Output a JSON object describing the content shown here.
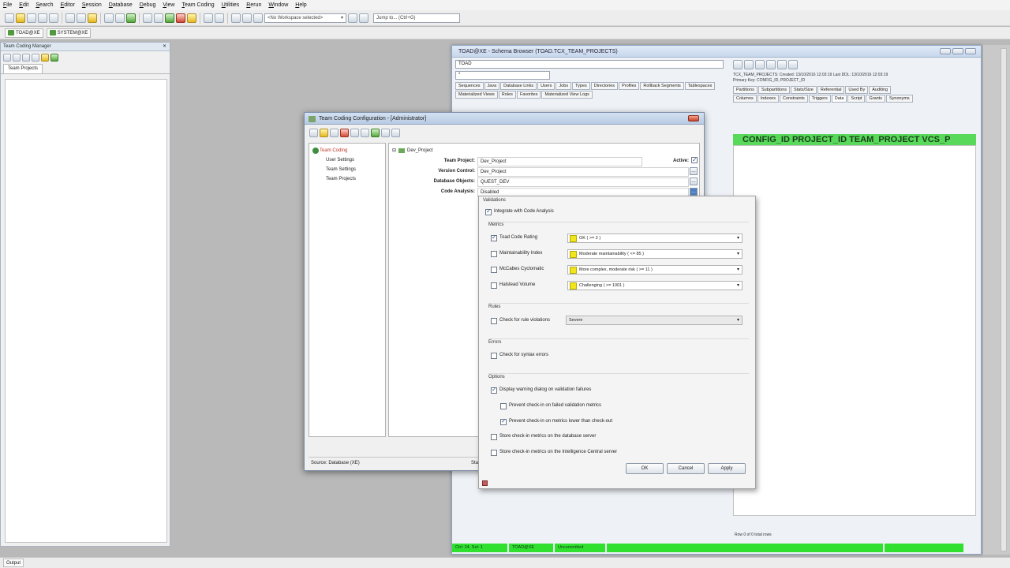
{
  "menu": [
    "File",
    "Edit",
    "Search",
    "Editor",
    "Session",
    "Database",
    "Debug",
    "View",
    "Team Coding",
    "Utilities",
    "Rerun",
    "Window",
    "Help"
  ],
  "toolbar": {
    "workspace_combo": "<No Workspace selected>",
    "jump_to": "Jump to... (Ctrl+G)"
  },
  "connections": [
    {
      "label": "TOAD@XE"
    },
    {
      "label": "SYSTEM@XE"
    }
  ],
  "left_panel": {
    "title": "Team Coding Manager",
    "tab": "Team Projects"
  },
  "bottom_bar": {
    "output_tab": "Output"
  },
  "schema_browser": {
    "title": "TOAD@XE - Schema Browser (TOAD.TCX_TEAM_PROJECTS)",
    "schema_combo": "TOAD",
    "filter_value": "*",
    "object_tabs": [
      "Sequences",
      "Java",
      "Database Links",
      "Users",
      "Jobs",
      "Types",
      "Directories",
      "Profiles",
      "Rollback Segments",
      "Tablespaces",
      "Materialized Views",
      "Roles",
      "Favorites",
      "Materialized View Logs"
    ],
    "info_line1": "TCX_TEAM_PROJECTS:  Created: 13/10/2016 12:03:19   Last DDL: 13/10/2016 12:03:19",
    "info_line2": "Primary Key: CONFIG_ID, PROJECT_ID",
    "detail_tabs_row1": [
      "Partitions",
      "Subpartitions",
      "Stats/Size",
      "Referential",
      "Used By",
      "Auditing"
    ],
    "detail_tabs_row2": [
      "Columns",
      "Indexes",
      "Constraints",
      "Triggers",
      "Data",
      "Script",
      "Grants",
      "Synonyms"
    ],
    "grid_header": "CONFIG_ID PROJECT_ID TEAM_PROJECT VCS_P",
    "row_status": "Row 0 of 0 total rows",
    "status_items": [
      "Ctrl: 24, Sel: 1",
      "TOAD@XE",
      "Uncommitted"
    ]
  },
  "tc_dialog": {
    "title": "Team Coding Configuration - [Administrator]",
    "tree": {
      "root": "Team Coding",
      "children": [
        "User Settings",
        "Team Settings",
        "Team Projects"
      ]
    },
    "project_node": "Dev_Project",
    "fields": {
      "team_project_label": "Team Project:",
      "team_project_value": "Dev_Project",
      "active_label": "Active:",
      "version_control_label": "Version Control:",
      "version_control_value": "Dev_Project",
      "database_objects_label": "Database Objects:",
      "database_objects_value": "QUEST_DEV",
      "code_analysis_label": "Code Analysis:",
      "code_analysis_value": "Disabled"
    },
    "status": "Source: Database (XE)",
    "status_right": "Sta"
  },
  "validations": {
    "title": "Validations",
    "integrate": "Integrate with Code Analysis",
    "metrics_header": "Metrics",
    "metrics": [
      {
        "label": "Toad Code Rating",
        "checked": true,
        "value": "OK ( >= 2 )"
      },
      {
        "label": "Maintainability Index",
        "checked": false,
        "value": "Moderate maintainability ( <= 85 )"
      },
      {
        "label": "McCabes Cyclomatic",
        "checked": false,
        "value": "More complex, moderate risk ( >= 11 )"
      },
      {
        "label": "Halstead Volume",
        "checked": false,
        "value": "Challenging ( >= 1001 )"
      }
    ],
    "rules_header": "Rules",
    "rules_check": "Check for rule violations",
    "rules_value": "Severe",
    "errors_header": "Errors",
    "errors_check": "Check for syntax errors",
    "options_header": "Options",
    "options": {
      "display_warning": "Display warning dialog on validation failures",
      "prevent_failed": "Prevent check-in on failed validation metrics",
      "prevent_lower": "Prevent check-in on metrics lower than check-out",
      "store_db": "Store check-in metrics on the database server",
      "store_ic": "Store check-in metrics on the Intelligence Central server"
    },
    "buttons": {
      "ok": "OK",
      "cancel": "Cancel",
      "apply": "Apply"
    }
  }
}
